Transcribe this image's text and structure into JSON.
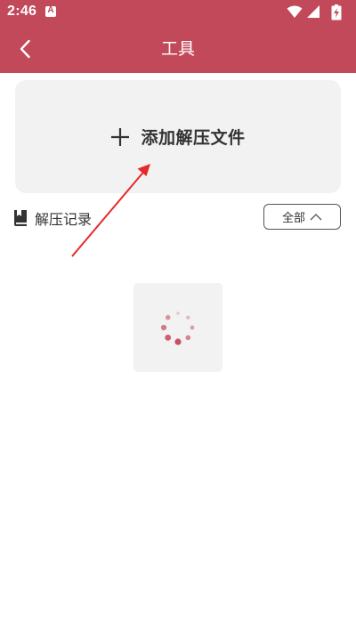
{
  "status_bar": {
    "time": "2:46",
    "notification_letter": "A",
    "icons": [
      "wifi-icon",
      "signal-icon",
      "battery-charging-icon"
    ]
  },
  "app_bar": {
    "title": "工具",
    "back_icon": "chevron-left-icon"
  },
  "add_card": {
    "icon": "plus-icon",
    "label": "添加解压文件"
  },
  "records": {
    "icon": "bookmark-book-icon",
    "title": "解压记录",
    "filter": {
      "label": "全部",
      "icon": "chevron-up-icon"
    }
  },
  "loader": {
    "icon": "loading-spinner-icon"
  },
  "colors": {
    "primary": "#c2495a",
    "card_bg": "#f2f2f2",
    "text": "#333333",
    "annotation_arrow": "#e52a2a"
  }
}
